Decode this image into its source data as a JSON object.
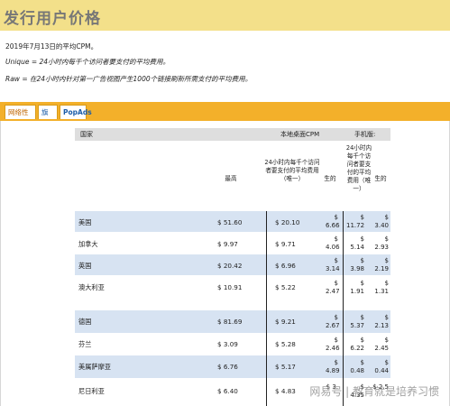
{
  "title": "发行用户价格",
  "intro": {
    "date_line": "2019年7月13日的平均CPM。",
    "unique_line": "Unique = 24小时内每千个访问者要支付的平均费用。",
    "raw_line": "Raw = 在24小时内针对第一广告视图产生1000个链接刷新所需支付的平均费用。"
  },
  "tabs": [
    "网络性",
    "旗帜",
    "PopAds"
  ],
  "table": {
    "header": {
      "country": "国家",
      "desktop": "本地桌面CPM",
      "mobile": "手机版:"
    },
    "subheader": {
      "highest": "最高",
      "unique_desktop": "24小时内每千个访问者要支付的平均费用（唯一）",
      "raw_desktop": "生的",
      "unique_mobile": "24小时内每千个访问者要支付的平均费用（唯一）",
      "raw_mobile": "生的"
    },
    "rows_group1": [
      {
        "country": "美国",
        "highest": "$ 51.60",
        "unique_d": "$ 20.10",
        "raw_d": "$ 6.66",
        "unique_m": "$ 11.72",
        "raw_m": "$ 3.40"
      },
      {
        "country": "加拿大",
        "highest": "$ 9.97",
        "unique_d": "$ 9.71",
        "raw_d": "$ 4.06",
        "unique_m": "$ 5.14",
        "raw_m": "$ 2.93"
      },
      {
        "country": "英国",
        "highest": "$ 20.42",
        "unique_d": "$ 6.96",
        "raw_d": "$ 3.14",
        "unique_m": "$ 3.98",
        "raw_m": "$ 2.19"
      },
      {
        "country": "澳大利亚",
        "highest": "$ 10.91",
        "unique_d": "$ 5.22",
        "raw_d": "$ 2.47",
        "unique_m": "$ 1.91",
        "raw_m": "$ 1.31"
      }
    ],
    "rows_group2": [
      {
        "country": "德国",
        "highest": "$ 81.69",
        "unique_d": "$ 9.21",
        "raw_d": "$ 2.67",
        "unique_m": "$ 5.37",
        "raw_m": "$ 2.13"
      },
      {
        "country": "芬兰",
        "highest": "$ 3.09",
        "unique_d": "$ 5.28",
        "raw_d": "$ 2.46",
        "unique_m": "$ 6.22",
        "raw_m": "$ 2.45"
      },
      {
        "country": "美属萨摩亚",
        "highest": "$ 6.76",
        "unique_d": "$ 5.17",
        "raw_d": "$ 4.89",
        "unique_m": "$ 0.48",
        "raw_m": "$ 0.44"
      },
      {
        "country": "尼日利亚",
        "highest": "$ 6.40",
        "unique_d": "$ 4.83",
        "raw_d": "$ 3.",
        "unique_m": "$ 4.35",
        "raw_m": "$ 2.5"
      }
    ]
  },
  "watermark": "网易号 | 教育就是培养习惯"
}
